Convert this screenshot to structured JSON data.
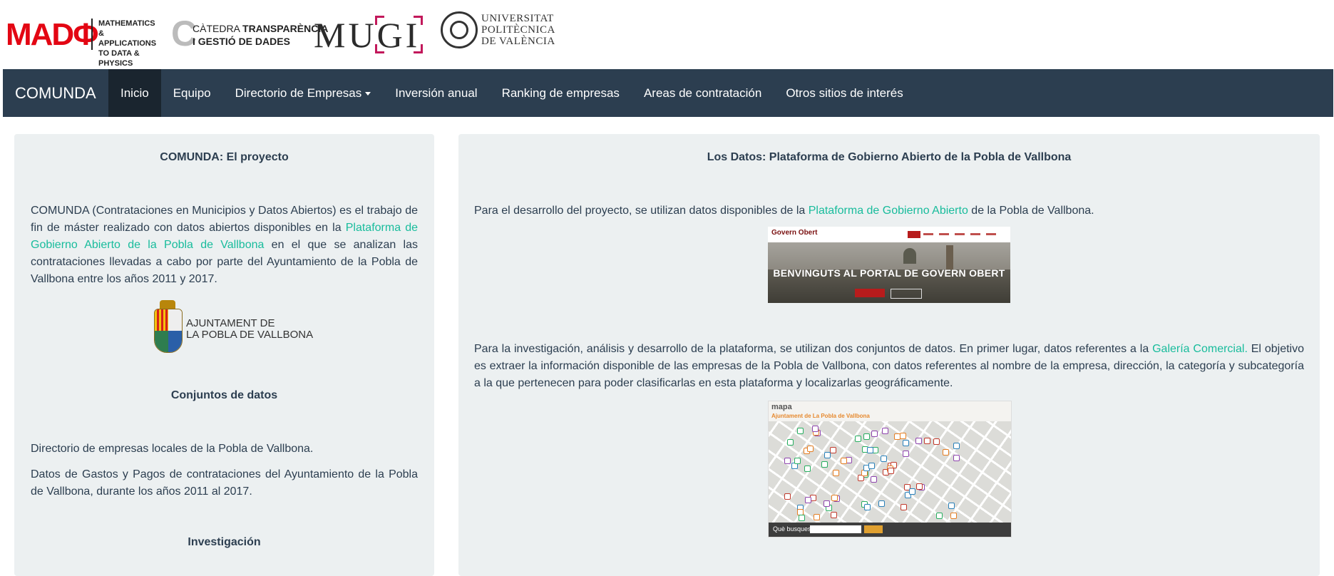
{
  "logos": {
    "madf": {
      "big": "MADΦ",
      "small": [
        "MATHEMATICS",
        "& APPLICATIONS",
        "TO DATA & PHYSICS"
      ]
    },
    "catedra": {
      "line1_a": "CÀTEDRA",
      "line1_b": "TRANSPARÈNCIA",
      "line2": "I GESTIÓ DE DADES"
    },
    "mugi": {
      "text": "MUGI"
    },
    "upv": {
      "lines": [
        "UNIVERSITAT",
        "POLITÈCNICA",
        "DE VALÈNCIA"
      ]
    }
  },
  "navbar": {
    "brand": "COMUNDA",
    "items": [
      {
        "label": "Inicio",
        "active": true
      },
      {
        "label": "Equipo"
      },
      {
        "label": "Directorio de Empresas"
      },
      {
        "label": "Inversión anual"
      },
      {
        "label": "Ranking de empresas"
      },
      {
        "label": "Areas de contratación"
      },
      {
        "label": "Otros sitios de interés"
      }
    ]
  },
  "left": {
    "title": "COMUNDA: El proyecto",
    "intro_a": "COMUNDA (Contrataciones en Municipios y Datos Abiertos) es el trabajo de fin de máster realizado con datos abiertos disponibles en la ",
    "intro_link": "Plataforma de Gobierno Abierto de la Pobla de Vallbona",
    "intro_b": " en el que se analizan las contrataciones llevadas a cabo por parte del Ayuntamiento de la Pobla de Vallbona entre los años 2011 y 2017.",
    "ayto_line1": "AJUNTAMENT DE",
    "ayto_line2": "LA POBLA DE VALLBONA",
    "datasets_title": "Conjuntos de datos",
    "dataset1": "Directorio de empresas locales de la Pobla de Vallbona.",
    "dataset2": "Datos de Gastos y Pagos de contrataciones del Ayuntamiento de la Pobla de Vallbona, durante los años 2011 al 2017.",
    "research_title": "Investigación"
  },
  "right": {
    "title": "Los Datos: Plataforma de Gobierno Abierto de la Pobla de Vallbona",
    "p1_a": "Para el desarrollo del proyecto, se utilizan datos disponibles de la ",
    "p1_link": "Plataforma de Gobierno Abierto",
    "p1_b": " de la Pobla de Vallbona.",
    "shot1_brand": "Govern Obert",
    "shot1_heading": "BENVINGUTS AL PORTAL DE GOVERN OBERT",
    "p2_a": "Para la investigación, análisis y desarrollo de la plataforma, se utilizan dos conjuntos de datos. En primer lugar, datos referentes a la ",
    "p2_link": "Galería Comercial.",
    "p2_b": " El objetivo es extraer la información disponible de las empresas de la Pobla de Vallbona, con datos referentes al nombre de la empresa, dirección, la categoría y subcategoría a la que pertenecen para poder clasificarlas en esta plataforma y localizarlas geográficamente.",
    "shot2_title": "mapa",
    "shot2_subtitle": "Ajuntament de La Pobla de Vallbona",
    "shot2_search": "Què busques?"
  },
  "colors": {
    "navbar": "#2c3e50",
    "active": "#1a252f",
    "link": "#18bc9c",
    "panel": "#ecf0f1",
    "madf": "#e30613",
    "mugi_accent": "#c2185b"
  }
}
